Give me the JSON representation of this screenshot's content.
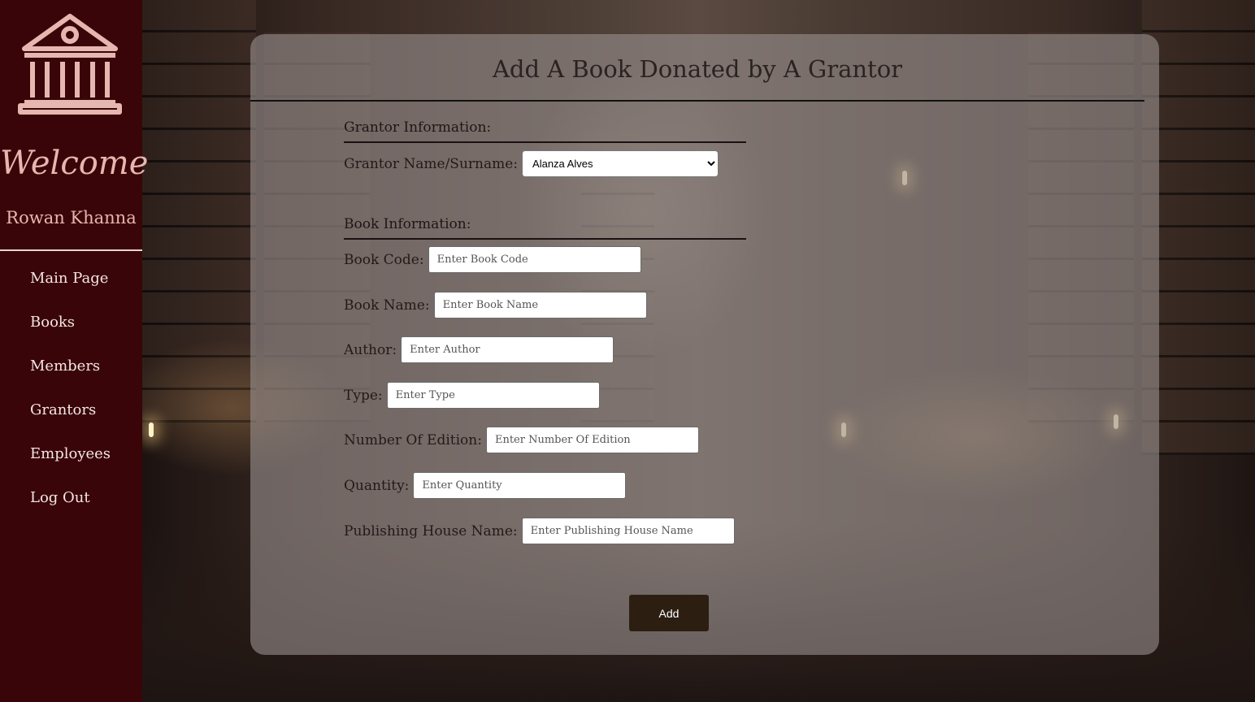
{
  "sidebar": {
    "logo_icon": "library-building-icon",
    "welcome": "Welcome",
    "user_name": "Rowan Khanna",
    "nav": [
      {
        "label": "Main Page"
      },
      {
        "label": "Books"
      },
      {
        "label": "Members"
      },
      {
        "label": "Grantors"
      },
      {
        "label": "Employees"
      },
      {
        "label": "Log Out"
      }
    ]
  },
  "main": {
    "title": "Add A Book Donated by A Grantor",
    "grantor_section": {
      "heading": "Grantor Information:",
      "name_label": "Grantor Name/Surname:",
      "selected_grantor": "Alanza Alves"
    },
    "book_section": {
      "heading": "Book Information:",
      "fields": [
        {
          "label": "Book Code:",
          "placeholder": "Enter Book Code",
          "value": ""
        },
        {
          "label": "Book Name:",
          "placeholder": "Enter Book Name",
          "value": ""
        },
        {
          "label": "Author:",
          "placeholder": "Enter Author",
          "value": ""
        },
        {
          "label": "Type:",
          "placeholder": "Enter Type",
          "value": ""
        },
        {
          "label": "Number Of Edition:",
          "placeholder": "Enter Number Of Edition",
          "value": ""
        },
        {
          "label": "Quantity:",
          "placeholder": "Enter Quantity",
          "value": ""
        },
        {
          "label": "Publishing House Name:",
          "placeholder": "Enter Publishing House Name",
          "value": ""
        }
      ]
    },
    "submit_label": "Add"
  },
  "colors": {
    "sidebar_bg": "#3a0508",
    "accent_text": "#e6b6b0",
    "button_bg": "#2c1f12"
  }
}
